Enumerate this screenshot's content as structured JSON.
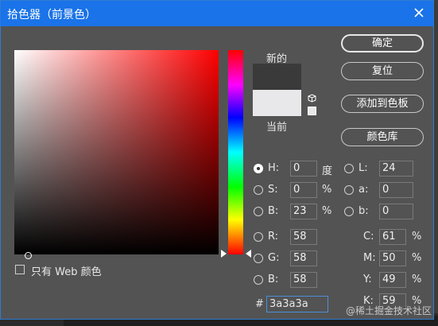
{
  "title": "拾色器（前景色）",
  "buttons": {
    "ok": "确定",
    "reset": "复位",
    "add_swatch": "添加到色板",
    "libraries": "颜色库"
  },
  "labels": {
    "new": "新的",
    "current": "当前"
  },
  "colors": {
    "new": "#3a3a3a",
    "current": "#e8e8ea"
  },
  "hsb": [
    {
      "label": "H:",
      "value": "0",
      "unit": "度",
      "selected": true
    },
    {
      "label": "S:",
      "value": "0",
      "unit": "%",
      "selected": false
    },
    {
      "label": "B:",
      "value": "23",
      "unit": "%",
      "selected": false
    }
  ],
  "lab": [
    {
      "label": "L:",
      "value": "24"
    },
    {
      "label": "a:",
      "value": "0"
    },
    {
      "label": "b:",
      "value": "0"
    }
  ],
  "rgb": [
    {
      "label": "R:",
      "value": "58"
    },
    {
      "label": "G:",
      "value": "58"
    },
    {
      "label": "B:",
      "value": "58"
    }
  ],
  "cmyk": [
    {
      "label": "C:",
      "value": "61",
      "unit": "%"
    },
    {
      "label": "M:",
      "value": "50",
      "unit": "%"
    },
    {
      "label": "Y:",
      "value": "49",
      "unit": "%"
    },
    {
      "label": "K:",
      "value": "59",
      "unit": "%"
    }
  ],
  "hex": {
    "label": "#",
    "value": "3a3a3a"
  },
  "web_only": {
    "label": "只有 Web 颜色",
    "checked": false
  },
  "watermark": "@稀土掘金技术社区"
}
